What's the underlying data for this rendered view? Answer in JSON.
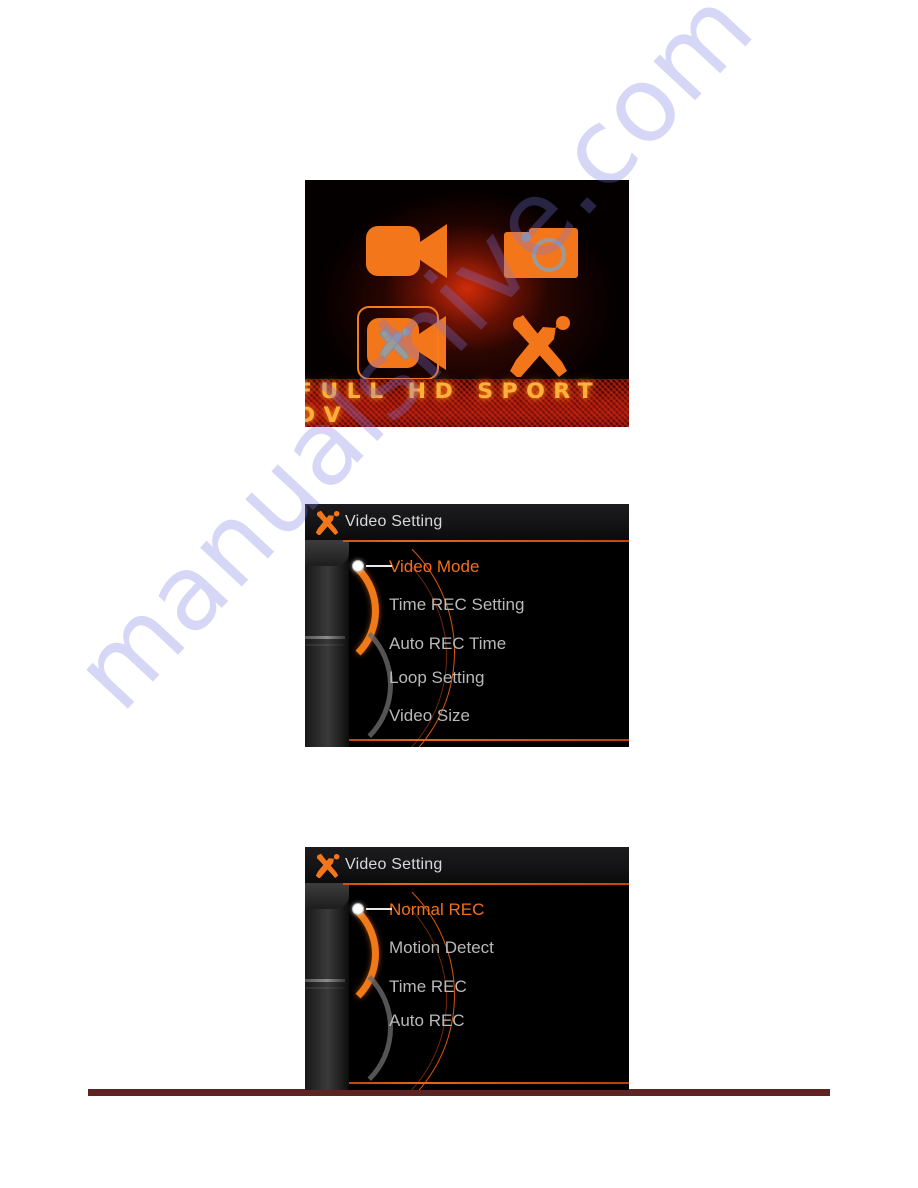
{
  "page": {
    "background_color": "#ffffff",
    "bottom_rule_color": "#5e2322"
  },
  "watermark": {
    "text": "manualshive.com",
    "color": "#7876e0"
  },
  "splash_screen": {
    "name": "Full HD Sport DV main menu",
    "banner_text": "FULL HD SPORT DV",
    "banner_text_color": "#ffb13c",
    "accent_color": "#f47b20",
    "glow_color": "#d72d0a",
    "icons": [
      {
        "id": "video-record",
        "label": "Video Record",
        "glyph": "video-camera-icon",
        "selected": false
      },
      {
        "id": "photo-capture",
        "label": "Photo Capture",
        "glyph": "photo-camera-icon",
        "selected": false
      },
      {
        "id": "video-setting",
        "label": "Video Setting",
        "glyph": "video-camera-tools-icon",
        "selected": true
      },
      {
        "id": "system-setup",
        "label": "System Setup",
        "glyph": "hammer-wrench-icon",
        "selected": false
      }
    ]
  },
  "menu_screens": [
    {
      "id": "video-setting-main",
      "title": "Video Setting",
      "title_icon": "hammer-wrench-icon",
      "selected_index": 0,
      "items": [
        {
          "label": "Video Mode",
          "selected": true
        },
        {
          "label": "Time REC Setting",
          "selected": false
        },
        {
          "label": "Auto REC Time",
          "selected": false
        },
        {
          "label": "Loop Setting",
          "selected": false
        },
        {
          "label": "Video Size",
          "selected": false
        }
      ]
    },
    {
      "id": "video-mode-submenu",
      "title": "Video Setting",
      "title_icon": "hammer-wrench-icon",
      "selected_index": 0,
      "items": [
        {
          "label": "Normal REC",
          "selected": true
        },
        {
          "label": "Motion Detect",
          "selected": false
        },
        {
          "label": "Time REC",
          "selected": false
        },
        {
          "label": "Auto REC",
          "selected": false
        }
      ]
    }
  ],
  "colors": {
    "selected_text": "#f1711a",
    "normal_text": "#b9b9b9",
    "title_text": "#d8d8d8",
    "rule_orange": "#e8651c",
    "screen_background": "#000000"
  }
}
